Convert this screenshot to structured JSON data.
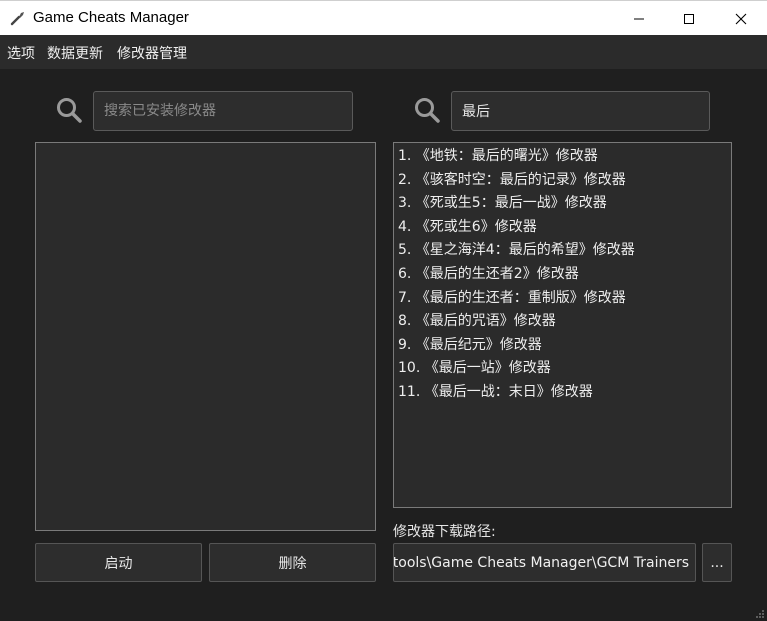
{
  "window": {
    "title": "Game Cheats Manager"
  },
  "menu": {
    "items": [
      "选项",
      "数据更新",
      "修改器管理"
    ]
  },
  "installed_search": {
    "placeholder": "搜索已安装修改器",
    "value": ""
  },
  "installed_list": {
    "items": []
  },
  "download_search": {
    "value": "最后"
  },
  "results": {
    "items": [
      "1. 《地铁：最后的曙光》修改器",
      "2. 《骇客时空：最后的记录》修改器",
      "3. 《死或生5：最后一战》修改器",
      "4. 《死或生6》修改器",
      "5. 《星之海洋4：最后的希望》修改器",
      "6. 《最后的生还者2》修改器",
      "7. 《最后的生还者：重制版》修改器",
      "8. 《最后的咒语》修改器",
      "9. 《最后纪元》修改器",
      "10. 《最后一站》修改器",
      "11. 《最后一战：末日》修改器"
    ]
  },
  "buttons": {
    "launch": "启动",
    "delete": "删除",
    "browse": "..."
  },
  "download_path": {
    "label": "修改器下载路径:",
    "value": "tools\\Game Cheats Manager\\GCM Trainers"
  },
  "icons": {
    "app": "wrench-icon",
    "search": "search-icon",
    "minimize": "minimize-icon",
    "maximize": "maximize-icon",
    "close": "close-icon"
  },
  "colors": {
    "background": "#1f1f1f",
    "panel": "#2b2b2b",
    "border": "#7a7a7a",
    "titlebar": "#ffffff"
  }
}
